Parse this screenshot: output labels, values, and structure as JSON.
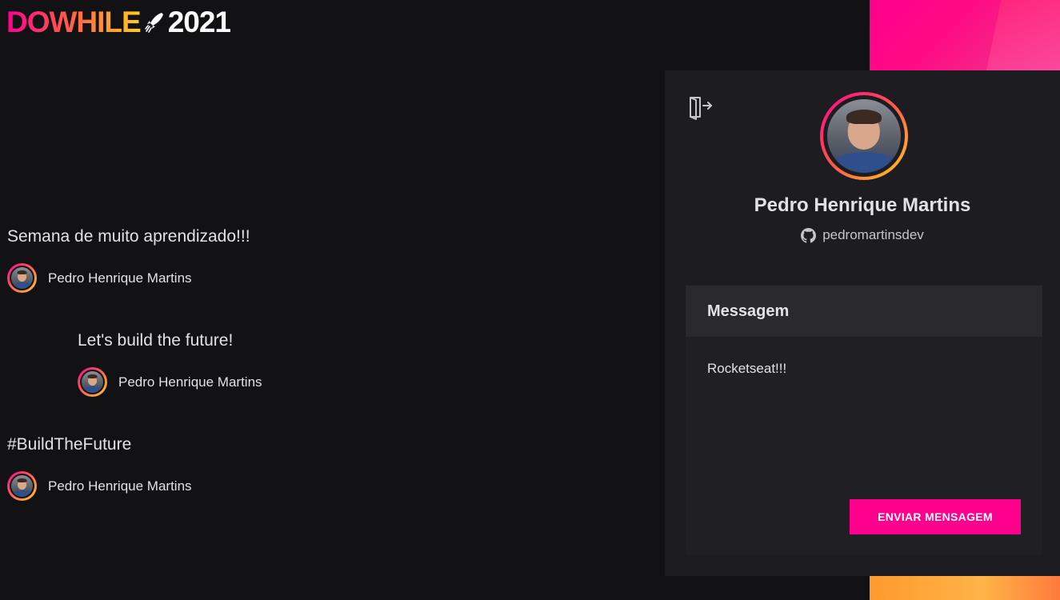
{
  "logo": {
    "word": "DOWHILE",
    "year": "2021",
    "colors": {
      "gradient_start": "#ff008e",
      "gradient_mid": "#ff5a4a",
      "gradient_end": "#ffcd1e"
    }
  },
  "messages": [
    {
      "text": "Semana de muito aprendizado!!!",
      "user_name": "Pedro Henrique Martins",
      "avatar": "user-avatar"
    },
    {
      "text": "Let's build the future!",
      "user_name": "Pedro Henrique Martins",
      "avatar": "user-avatar"
    },
    {
      "text": "#BuildTheFuture",
      "user_name": "Pedro Henrique Martins",
      "avatar": "user-avatar"
    }
  ],
  "profile": {
    "name": "Pedro Henrique Martins",
    "github_username": "pedromartinsdev",
    "logout_icon": "sign-out-icon",
    "github_icon": "github-icon"
  },
  "form": {
    "title": "Messagem",
    "message_value": "Rocketseat!!!",
    "send_label": "ENVIAR MENSAGEM"
  },
  "colors": {
    "background": "#121214",
    "panel": "#1d1d21",
    "form_header": "#29292e",
    "accent": "#ff008e",
    "text": "#e1e1e6"
  }
}
